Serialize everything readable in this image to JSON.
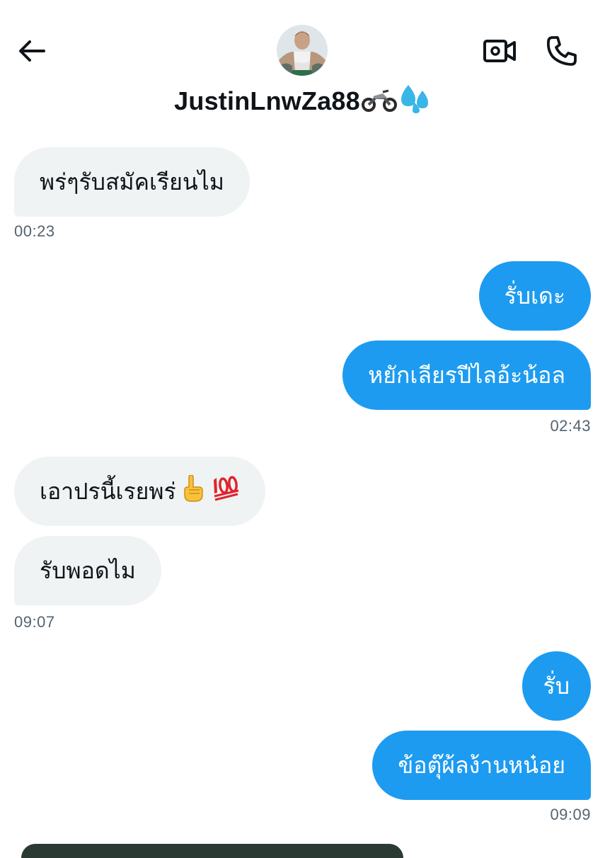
{
  "header": {
    "contact_name": "JustinLnwZa88",
    "name_emojis": [
      "motorcycle-emoji",
      "sweat-droplets-emoji"
    ],
    "icons": [
      "back-arrow-icon",
      "video-call-icon",
      "phone-icon"
    ]
  },
  "messages": [
    {
      "side": "in",
      "text": "พร่ๆรับสมัคเรียนไม"
    },
    {
      "side": "in",
      "time": "00:23"
    },
    {
      "side": "out",
      "text": "รั่บเดะ"
    },
    {
      "side": "out",
      "text": "หยักเลียรปีไลอ้ะน้อล"
    },
    {
      "side": "out",
      "time": "02:43"
    },
    {
      "side": "in",
      "text": "เอาปรนี้เรยพร่",
      "emojis": [
        "pointing-up-emoji",
        "hundred-points-emoji"
      ]
    },
    {
      "side": "in",
      "text": "รับพอดไม"
    },
    {
      "side": "in",
      "time": "09:07"
    },
    {
      "side": "out",
      "text": "รั่บ"
    },
    {
      "side": "out",
      "text": "ข้อตุ๊ผ้ลง้านหน๋อย"
    },
    {
      "side": "out",
      "time": "09:09"
    }
  ],
  "colors": {
    "outgoing_bubble": "#1d9bf0",
    "incoming_bubble": "#eff3f4",
    "timestamp": "#536471",
    "text": "#0f1419"
  }
}
